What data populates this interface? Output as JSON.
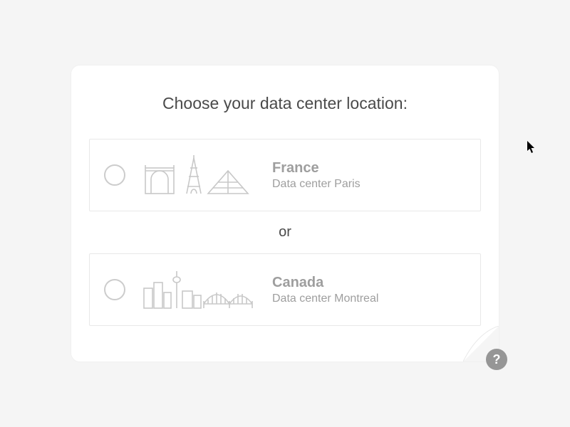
{
  "title": "Choose your data center location:",
  "divider": "or",
  "options": [
    {
      "title": "France",
      "subtitle": "Data center Paris"
    },
    {
      "title": "Canada",
      "subtitle": "Data center Montreal"
    }
  ],
  "help_label": "?"
}
